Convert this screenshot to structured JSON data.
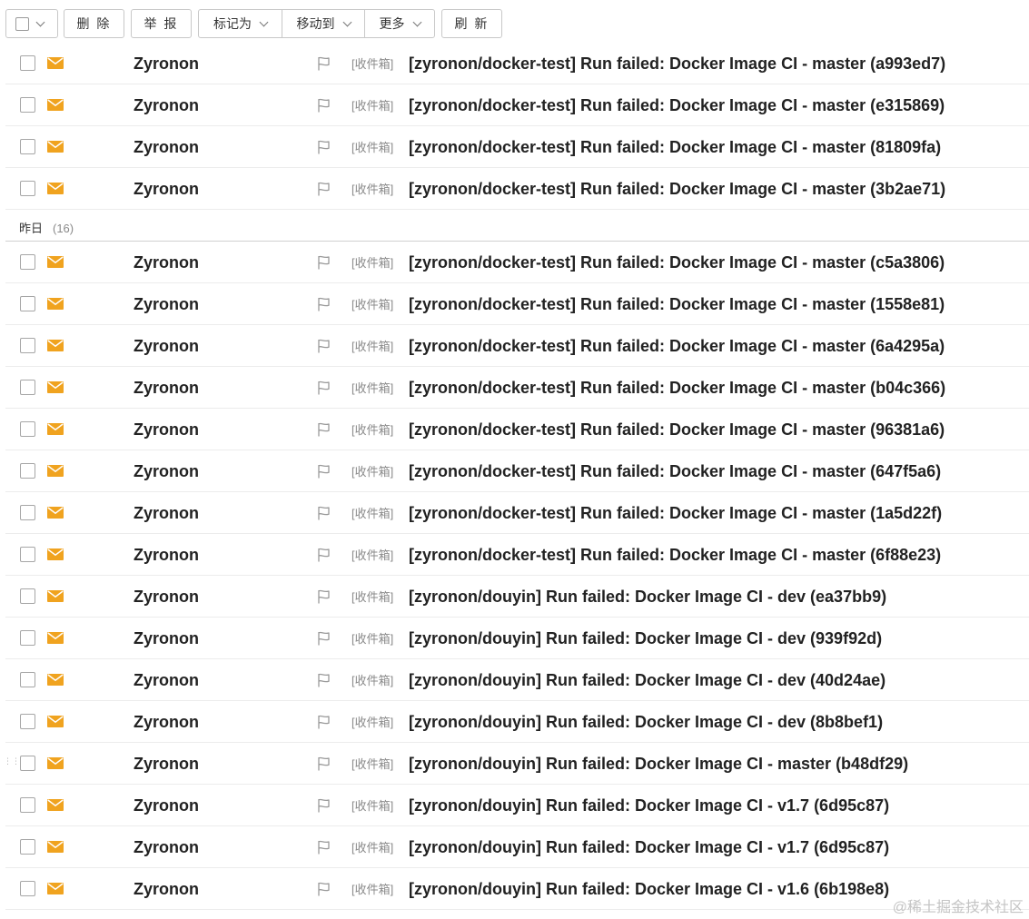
{
  "toolbar": {
    "delete_label": "删 除",
    "report_label": "举 报",
    "mark_as_label": "标记为",
    "move_to_label": "移动到",
    "more_label": "更多",
    "refresh_label": "刷 新"
  },
  "groups": {
    "yesterday": {
      "label": "昨日",
      "count": "(16)"
    }
  },
  "icons": {
    "mail": "envelope-icon",
    "flag": "flag-icon",
    "checkbox": "checkbox-icon",
    "chevron": "chevron-down-icon"
  },
  "colors": {
    "envelope": "#f0a31f",
    "sender_text": "#222222",
    "folder_tag": "#8a8a8a"
  },
  "emails_today": [
    {
      "sender": "Zyronon",
      "folder": "[收件箱]",
      "subject": "[zyronon/docker-test] Run failed: Docker Image CI - master (a993ed7)"
    },
    {
      "sender": "Zyronon",
      "folder": "[收件箱]",
      "subject": "[zyronon/docker-test] Run failed: Docker Image CI - master (e315869)"
    },
    {
      "sender": "Zyronon",
      "folder": "[收件箱]",
      "subject": "[zyronon/docker-test] Run failed: Docker Image CI - master (81809fa)"
    },
    {
      "sender": "Zyronon",
      "folder": "[收件箱]",
      "subject": "[zyronon/docker-test] Run failed: Docker Image CI - master (3b2ae71)"
    }
  ],
  "emails_yesterday": [
    {
      "sender": "Zyronon",
      "folder": "[收件箱]",
      "subject": "[zyronon/docker-test] Run failed: Docker Image CI - master (c5a3806)"
    },
    {
      "sender": "Zyronon",
      "folder": "[收件箱]",
      "subject": "[zyronon/docker-test] Run failed: Docker Image CI - master (1558e81)"
    },
    {
      "sender": "Zyronon",
      "folder": "[收件箱]",
      "subject": "[zyronon/docker-test] Run failed: Docker Image CI - master (6a4295a)"
    },
    {
      "sender": "Zyronon",
      "folder": "[收件箱]",
      "subject": "[zyronon/docker-test] Run failed: Docker Image CI - master (b04c366)"
    },
    {
      "sender": "Zyronon",
      "folder": "[收件箱]",
      "subject": "[zyronon/docker-test] Run failed: Docker Image CI - master (96381a6)"
    },
    {
      "sender": "Zyronon",
      "folder": "[收件箱]",
      "subject": "[zyronon/docker-test] Run failed: Docker Image CI - master (647f5a6)"
    },
    {
      "sender": "Zyronon",
      "folder": "[收件箱]",
      "subject": "[zyronon/docker-test] Run failed: Docker Image CI - master (1a5d22f)"
    },
    {
      "sender": "Zyronon",
      "folder": "[收件箱]",
      "subject": "[zyronon/docker-test] Run failed: Docker Image CI - master (6f88e23)"
    },
    {
      "sender": "Zyronon",
      "folder": "[收件箱]",
      "subject": "[zyronon/douyin] Run failed: Docker Image CI - dev (ea37bb9)"
    },
    {
      "sender": "Zyronon",
      "folder": "[收件箱]",
      "subject": "[zyronon/douyin] Run failed: Docker Image CI - dev (939f92d)"
    },
    {
      "sender": "Zyronon",
      "folder": "[收件箱]",
      "subject": "[zyronon/douyin] Run failed: Docker Image CI - dev (40d24ae)"
    },
    {
      "sender": "Zyronon",
      "folder": "[收件箱]",
      "subject": "[zyronon/douyin] Run failed: Docker Image CI - dev (8b8bef1)"
    },
    {
      "sender": "Zyronon",
      "folder": "[收件箱]",
      "subject": "[zyronon/douyin] Run failed: Docker Image CI - master (b48df29)"
    },
    {
      "sender": "Zyronon",
      "folder": "[收件箱]",
      "subject": "[zyronon/douyin] Run failed: Docker Image CI - v1.7 (6d95c87)"
    },
    {
      "sender": "Zyronon",
      "folder": "[收件箱]",
      "subject": "[zyronon/douyin] Run failed: Docker Image CI - v1.7 (6d95c87)"
    },
    {
      "sender": "Zyronon",
      "folder": "[收件箱]",
      "subject": "[zyronon/douyin] Run failed: Docker Image CI - v1.6 (6b198e8)"
    }
  ],
  "watermark": "@稀土掘金技术社区"
}
